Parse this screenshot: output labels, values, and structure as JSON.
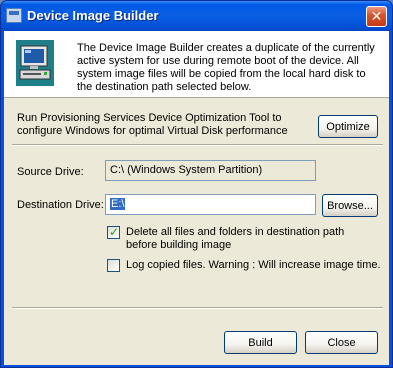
{
  "window": {
    "title": "Device Image Builder",
    "close_symbol": "✕"
  },
  "banner": {
    "icon": "computer-icon",
    "description": "The Device Image Builder creates a duplicate of the currently active system for use during remote boot of the device.  All system image files will be copied from the local hard disk to the destination path selected below."
  },
  "optimize": {
    "text": "Run Provisioning Services Device Optimization Tool to configure Windows for optimal Virtual Disk performance",
    "button_label": "Optimize"
  },
  "source": {
    "label": "Source Drive:",
    "value": "C:\\  (Windows System Partition)"
  },
  "destination": {
    "label": "Destination Drive:",
    "value": "E:\\",
    "browse_label": "Browse..."
  },
  "options": {
    "delete_files": {
      "label": "Delete all files and folders in destination path before building image",
      "checked": true
    },
    "log_files": {
      "label": "Log copied files. Warning : Will increase image time.",
      "checked": false
    }
  },
  "footer": {
    "build_label": "Build",
    "close_label": "Close"
  },
  "colors": {
    "titlebar": "#0058e6",
    "dialog_bg": "#ece9d8",
    "close_button": "#d4532b",
    "selection": "#316ac5",
    "checkmark": "#21a121"
  }
}
